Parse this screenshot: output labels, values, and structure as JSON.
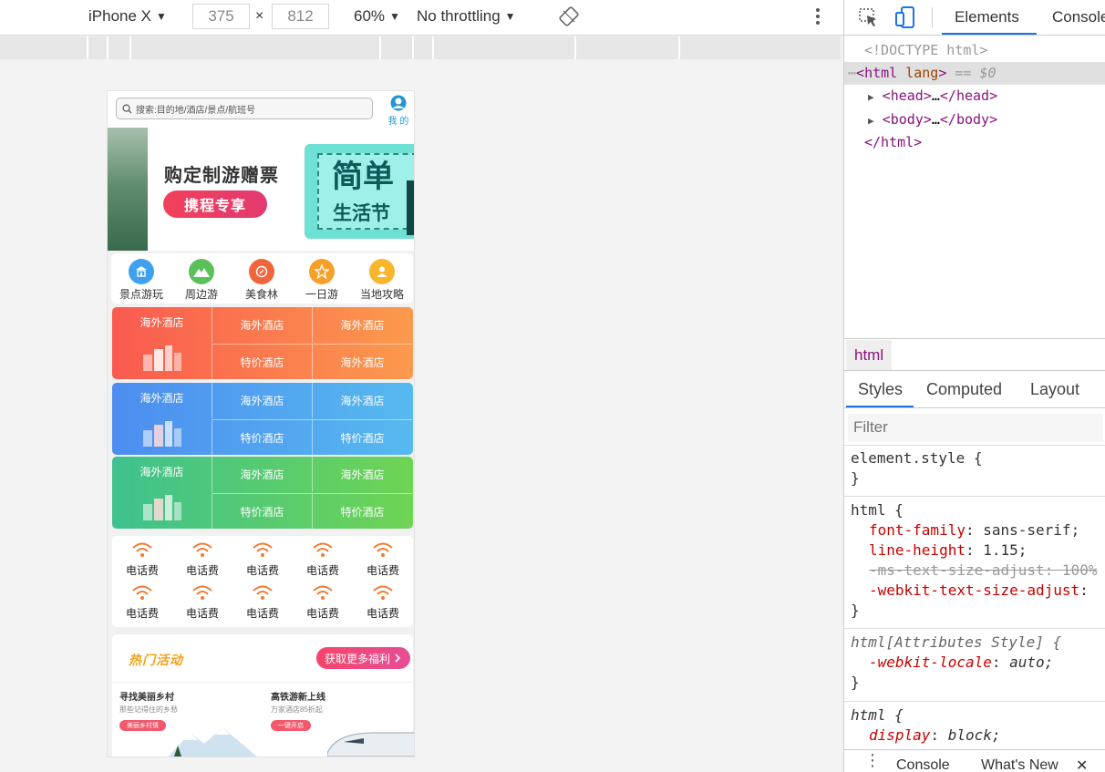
{
  "toolbar": {
    "device": "iPhone X",
    "width": "375",
    "times": "×",
    "height": "812",
    "zoom": "60%",
    "throttling": "No throttling"
  },
  "app": {
    "search_placeholder": "搜索:目的地/酒店/景点/航班号",
    "mine_label": "我 的",
    "banner": {
      "title": "购定制游赠票",
      "button": "携程专享",
      "ticket_line1": "简单",
      "ticket_line2": "生活节"
    },
    "categories": [
      {
        "label": "景点游玩",
        "icon": "attraction-icon",
        "color": "#3fa0f0"
      },
      {
        "label": "周边游",
        "icon": "mountain-icon",
        "color": "#5cc05a"
      },
      {
        "label": "美食林",
        "icon": "food-icon",
        "color": "#f2643a"
      },
      {
        "label": "一日游",
        "icon": "day-tour-icon",
        "color": "#f6a02a"
      },
      {
        "label": "当地攻略",
        "icon": "guide-icon",
        "color": "#f7b62c"
      }
    ],
    "hotel_blocks": [
      {
        "main": "海外酒店",
        "cells": [
          "海外酒店",
          "海外酒店",
          "特价酒店",
          "海外酒店"
        ],
        "gradient": [
          "#fa5a4f",
          "#fb9a4d"
        ]
      },
      {
        "main": "海外酒店",
        "cells": [
          "海外酒店",
          "海外酒店",
          "特价酒店",
          "特价酒店"
        ],
        "gradient": [
          "#4d8df0",
          "#56b9ef"
        ]
      },
      {
        "main": "海外酒店",
        "cells": [
          "海外酒店",
          "海外酒店",
          "特价酒店",
          "特价酒店"
        ],
        "gradient": [
          "#3fc18f",
          "#6ed454"
        ]
      }
    ],
    "phone_items": [
      "电话费",
      "电话费",
      "电话费",
      "电话费",
      "电话费",
      "电话费",
      "电话费",
      "电话费",
      "电话费",
      "电话费"
    ],
    "activity": {
      "title": "热门活动",
      "button": "获取更多福利",
      "promos": [
        {
          "title": "寻找美丽乡村",
          "subtitle": "那些记得住的乡愁",
          "badge": "美丽乡村情"
        },
        {
          "title": "高铁游新上线",
          "subtitle": "万家酒店85折起",
          "badge": "一键开启"
        }
      ]
    }
  },
  "devtools": {
    "tabs": [
      "Elements",
      "Console"
    ],
    "dom": {
      "doctype": "<!DOCTYPE html>",
      "html_open_tag": "html",
      "html_attr": "lang",
      "selected_marker": "== $0",
      "head": "head",
      "body": "body",
      "html_close": "</html>"
    },
    "breadcrumb": "html",
    "style_tabs": [
      "Styles",
      "Computed",
      "Layout"
    ],
    "filter_placeholder": "Filter",
    "rules": {
      "element_style": "element.style {",
      "html_sel": "html {",
      "font_family_prop": "font-family",
      "font_family_val": "sans-serif;",
      "line_height_prop": "line-height",
      "line_height_val": "1.15;",
      "ms_adjust": "-ms-text-size-adjust: 100%",
      "webkit_adjust_prop": "-webkit-text-size-adjust",
      "attr_style_sel": "html[Attributes Style] {",
      "webkit_locale_prop": "-webkit-locale",
      "webkit_locale_val": "auto;",
      "html_sel2": "html {",
      "display_prop": "display",
      "display_val": "block;"
    },
    "drawer": [
      "Console",
      "What's New"
    ]
  }
}
